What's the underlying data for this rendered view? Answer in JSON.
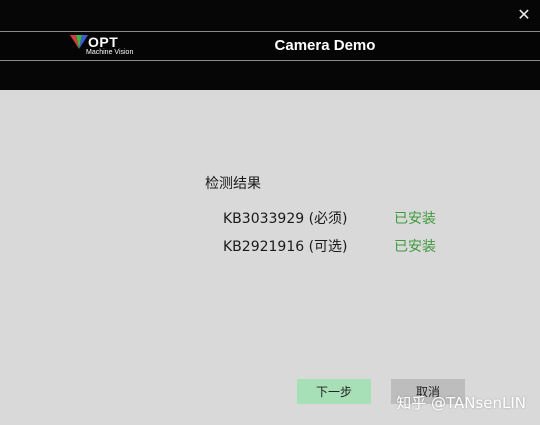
{
  "window": {
    "close_glyph": "✕",
    "title": "Camera Demo",
    "logo": {
      "name": "OPT",
      "sub": "Machine Vision"
    }
  },
  "main": {
    "section_title": "检测结果",
    "items": [
      {
        "label": "KB3033929 (必须)",
        "status": "已安装"
      },
      {
        "label": "KB2921916 (可选)",
        "status": "已安装"
      }
    ]
  },
  "buttons": {
    "next": "下一步",
    "cancel": "取消"
  },
  "watermark": "知乎 @TANsenLIN",
  "colors": {
    "header_bg": "#060606",
    "body_bg": "#d9d9d9",
    "status_green": "#3f9a3f",
    "next_button": "#a7dfb6",
    "cancel_button": "#bdbdbd"
  }
}
